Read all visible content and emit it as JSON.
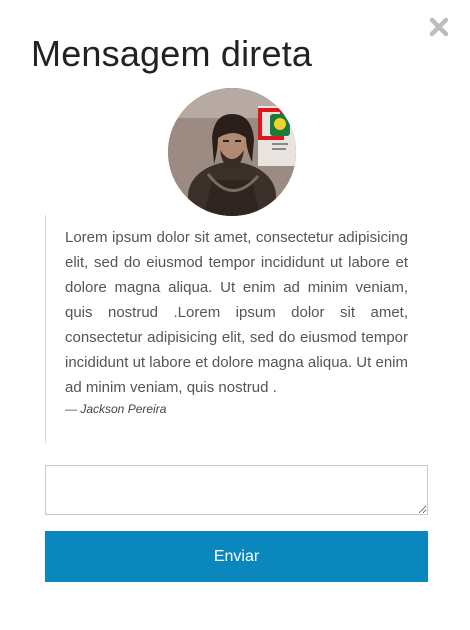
{
  "modal": {
    "title": "Mensagem direta",
    "close_icon": "close-icon",
    "avatar": "profile-photo"
  },
  "quote": {
    "text": "Lorem ipsum dolor sit amet, consectetur adipisicing elit, sed do eiusmod tempor incididunt ut labore et dolore magna aliqua. Ut enim ad minim veniam, quis nostrud .Lorem ipsum dolor sit amet, consectetur adipisicing elit, sed do eiusmod tempor incididunt ut labore et dolore magna aliqua. Ut enim ad minim veniam, quis nostrud .",
    "author": "— Jackson Pereira"
  },
  "form": {
    "message_value": "",
    "send_label": "Enviar"
  },
  "colors": {
    "accent": "#0a87bd",
    "close_icon": "#bdbdbd"
  }
}
